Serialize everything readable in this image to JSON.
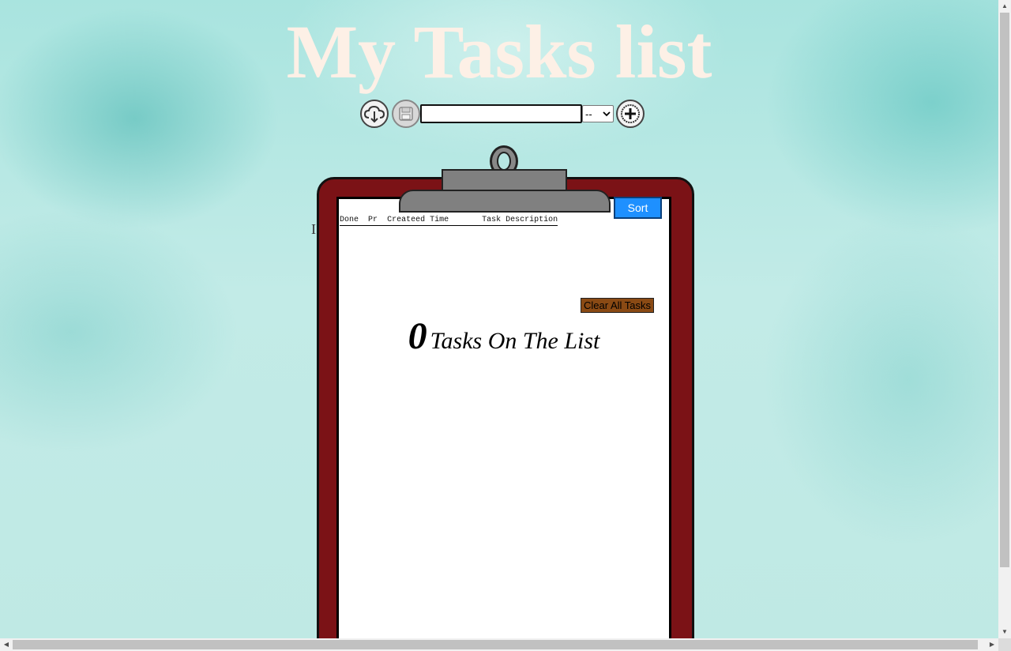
{
  "page": {
    "title": "My Tasks list"
  },
  "toolbar": {
    "download_icon": "cloud-download-icon",
    "save_icon": "save-disk-icon",
    "add_icon": "plus-circle-icon",
    "task_input_value": "",
    "priority_selected": "--"
  },
  "clipboard": {
    "sort_label": "Sort",
    "headers": {
      "done": "Done",
      "priority": "Pr",
      "created_time": "Createed Time",
      "description": "Task Description"
    },
    "clear_label": "Clear All Tasks",
    "task_count": "0",
    "task_count_label": "Tasks On The List"
  },
  "colors": {
    "title": "#fdf0e6",
    "board": "#7b1216",
    "sort_button": "#1e90ff",
    "clear_button": "#8a4a14"
  }
}
